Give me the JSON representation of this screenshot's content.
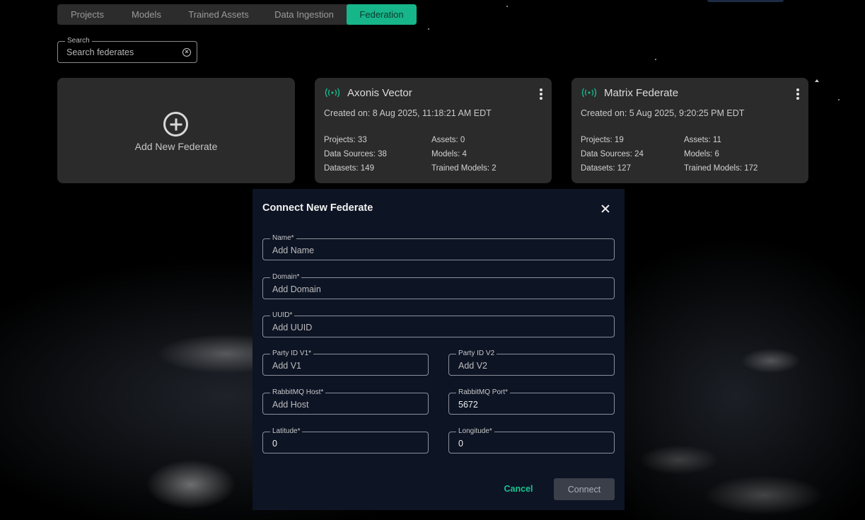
{
  "tabs": [
    {
      "label": "Projects"
    },
    {
      "label": "Models"
    },
    {
      "label": "Trained Assets"
    },
    {
      "label": "Data Ingestion"
    },
    {
      "label": "Federation"
    }
  ],
  "search": {
    "label": "Search",
    "placeholder": "Search federates"
  },
  "add_card": {
    "label": "Add New Federate"
  },
  "federates": [
    {
      "name": "Axonis Vector",
      "created": "Created on: 8 Aug 2025, 11:18:21 AM EDT",
      "projects": "Projects: 33",
      "assets": "Assets: 0",
      "data_sources": "Data Sources: 38",
      "models": "Models: 4",
      "datasets": "Datasets: 149",
      "trained_models": "Trained Models: 2"
    },
    {
      "name": "Matrix Federate",
      "created": "Created on: 5 Aug 2025, 9:20:25 PM EDT",
      "projects": "Projects: 19",
      "assets": "Assets: 11",
      "data_sources": "Data Sources: 24",
      "models": "Models: 6",
      "datasets": "Datasets: 127",
      "trained_models": "Trained Models: 172"
    }
  ],
  "modal": {
    "title": "Connect New Federate",
    "fields": {
      "name": {
        "label": "Name*",
        "placeholder": "Add Name",
        "value": ""
      },
      "domain": {
        "label": "Domain*",
        "placeholder": "Add Domain",
        "value": ""
      },
      "uuid": {
        "label": "UUID*",
        "placeholder": "Add UUID",
        "value": ""
      },
      "party_v1": {
        "label": "Party ID V1*",
        "placeholder": "Add V1",
        "value": ""
      },
      "party_v2": {
        "label": "Party ID V2",
        "placeholder": "Add V2",
        "value": ""
      },
      "rabbit_host": {
        "label": "RabbitMQ Host*",
        "placeholder": "Add Host",
        "value": ""
      },
      "rabbit_port": {
        "label": "RabbitMQ Port*",
        "placeholder": "",
        "value": "5672"
      },
      "latitude": {
        "label": "Latitude*",
        "placeholder": "",
        "value": "0"
      },
      "longitude": {
        "label": "Longitude*",
        "placeholder": "",
        "value": "0"
      }
    },
    "cancel_label": "Cancel",
    "connect_label": "Connect"
  },
  "colors": {
    "accent": "#17b58a",
    "card_bg": "#2b2b2b",
    "modal_bg": "#0d1424",
    "signal_icon": "#17b58a"
  }
}
